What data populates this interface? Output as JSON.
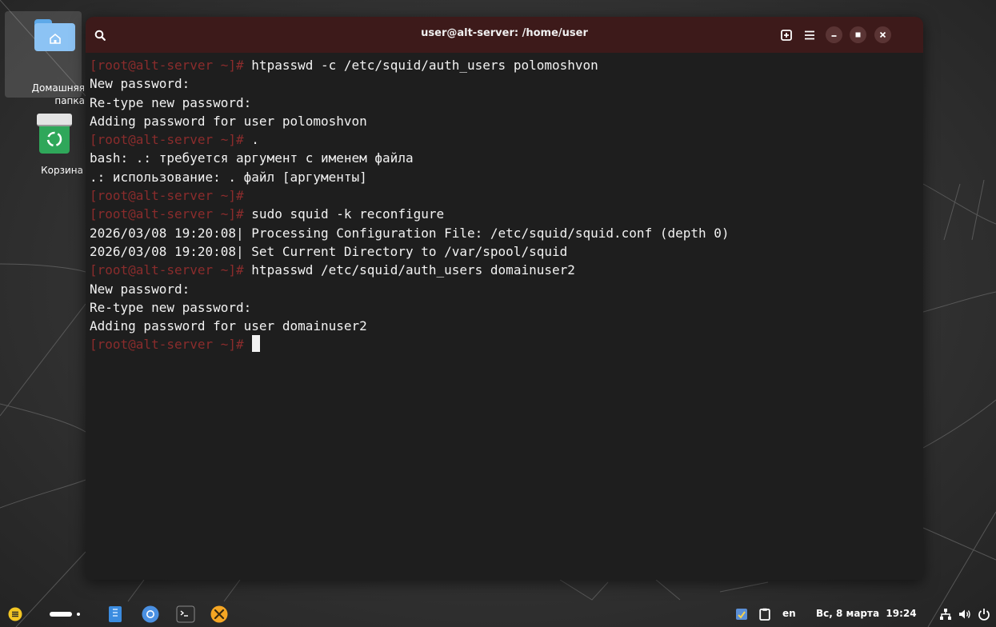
{
  "desktop": {
    "icons": [
      {
        "label": "Домашняя папка",
        "icon": "home-folder-icon"
      },
      {
        "label": "Корзина",
        "icon": "trash-icon"
      }
    ]
  },
  "window": {
    "title": "user@alt-server: /home/user",
    "titlebar_color": "#3d1a1a",
    "background": "#1e1e1e",
    "prompt_color": "#8a2c2c",
    "buttons": [
      "search-icon",
      "new-tab-icon",
      "hamburger-menu-icon",
      "minimize-icon",
      "maximize-icon",
      "close-icon"
    ]
  },
  "terminal": {
    "lines": [
      {
        "prompt": "[root@alt-server ~]# ",
        "text": "htpasswd -c /etc/squid/auth_users polomoshvon"
      },
      {
        "prompt": "",
        "text": "New password:"
      },
      {
        "prompt": "",
        "text": "Re-type new password:"
      },
      {
        "prompt": "",
        "text": "Adding password for user polomoshvon"
      },
      {
        "prompt": "[root@alt-server ~]# ",
        "text": "."
      },
      {
        "prompt": "",
        "text": "bash: .: требуется аргумент с именем файла"
      },
      {
        "prompt": "",
        "text": ".: использование: . файл [аргументы]"
      },
      {
        "prompt": "[root@alt-server ~]# ",
        "text": ""
      },
      {
        "prompt": "[root@alt-server ~]# ",
        "text": "sudo squid -k reconfigure"
      },
      {
        "prompt": "",
        "text": "2026/03/08 19:20:08| Processing Configuration File: /etc/squid/squid.conf (depth 0)"
      },
      {
        "prompt": "",
        "text": "2026/03/08 19:20:08| Set Current Directory to /var/spool/squid"
      },
      {
        "prompt": "[root@alt-server ~]# ",
        "text": "htpasswd /etc/squid/auth_users domainuser2"
      },
      {
        "prompt": "",
        "text": "New password:"
      },
      {
        "prompt": "",
        "text": "Re-type new password:"
      },
      {
        "prompt": "",
        "text": "Adding password for user domainuser2"
      }
    ],
    "current_prompt": "[root@alt-server ~]# "
  },
  "taskbar": {
    "apps": [
      "app-menu-icon",
      "workspace-indicator-icon",
      "file-manager-icon",
      "chromium-icon",
      "terminal-icon",
      "settings-tools-icon"
    ],
    "tray": {
      "layout": "en",
      "datetime": "Вс, 8 марта  19:24",
      "icons": [
        "notes-icon",
        "clipboard-icon",
        "network-icon",
        "volume-icon",
        "power-icon"
      ]
    }
  }
}
